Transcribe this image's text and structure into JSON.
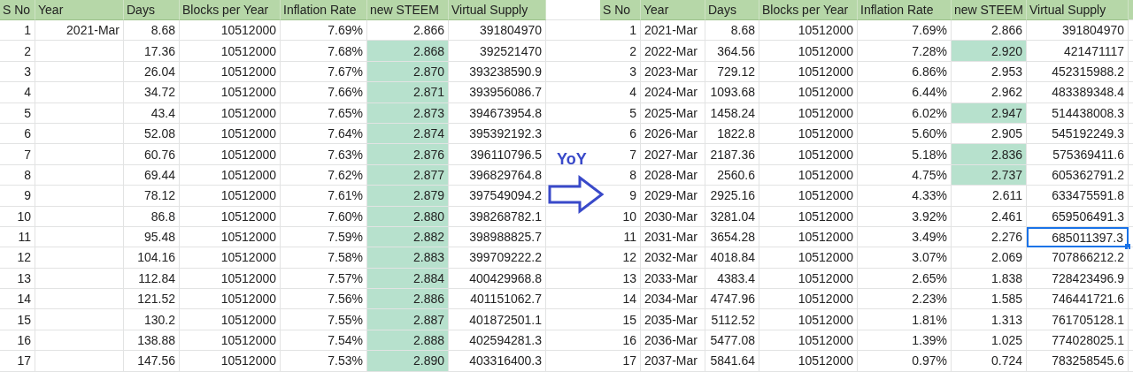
{
  "tables": [
    {
      "columns": [
        "S No",
        "Year",
        "Days",
        "Blocks per Year",
        "Inflation Rate",
        "new STEEM",
        "Virtual Supply"
      ],
      "rows": [
        {
          "s_no": "1",
          "year": "2021-Mar",
          "days": "8.68",
          "blocks_per_year": "10512000",
          "inflation_rate": "7.69%",
          "new_steem": "2.866",
          "virtual_supply": "391804970",
          "new_steem_highlighted": false,
          "selected": false
        },
        {
          "s_no": "2",
          "days": "17.36",
          "blocks_per_year": "10512000",
          "inflation_rate": "7.68%",
          "new_steem": "2.868",
          "virtual_supply": "392521470",
          "new_steem_highlighted": true,
          "selected": false
        },
        {
          "s_no": "3",
          "days": "26.04",
          "blocks_per_year": "10512000",
          "inflation_rate": "7.67%",
          "new_steem": "2.870",
          "virtual_supply": "393238590.9",
          "new_steem_highlighted": true,
          "selected": false
        },
        {
          "s_no": "4",
          "days": "34.72",
          "blocks_per_year": "10512000",
          "inflation_rate": "7.66%",
          "new_steem": "2.871",
          "virtual_supply": "393956086.7",
          "new_steem_highlighted": true,
          "selected": false
        },
        {
          "s_no": "5",
          "days": "43.4",
          "blocks_per_year": "10512000",
          "inflation_rate": "7.65%",
          "new_steem": "2.873",
          "virtual_supply": "394673954.8",
          "new_steem_highlighted": true,
          "selected": false
        },
        {
          "s_no": "6",
          "days": "52.08",
          "blocks_per_year": "10512000",
          "inflation_rate": "7.64%",
          "new_steem": "2.874",
          "virtual_supply": "395392192.3",
          "new_steem_highlighted": true,
          "selected": false
        },
        {
          "s_no": "7",
          "days": "60.76",
          "blocks_per_year": "10512000",
          "inflation_rate": "7.63%",
          "new_steem": "2.876",
          "virtual_supply": "396110796.5",
          "new_steem_highlighted": true,
          "selected": false
        },
        {
          "s_no": "8",
          "days": "69.44",
          "blocks_per_year": "10512000",
          "inflation_rate": "7.62%",
          "new_steem": "2.877",
          "virtual_supply": "396829764.8",
          "new_steem_highlighted": true,
          "selected": false
        },
        {
          "s_no": "9",
          "days": "78.12",
          "blocks_per_year": "10512000",
          "inflation_rate": "7.61%",
          "new_steem": "2.879",
          "virtual_supply": "397549094.2",
          "new_steem_highlighted": true,
          "selected": false
        },
        {
          "s_no": "10",
          "days": "86.8",
          "blocks_per_year": "10512000",
          "inflation_rate": "7.60%",
          "new_steem": "2.880",
          "virtual_supply": "398268782.1",
          "new_steem_highlighted": true,
          "selected": false
        },
        {
          "s_no": "11",
          "days": "95.48",
          "blocks_per_year": "10512000",
          "inflation_rate": "7.59%",
          "new_steem": "2.882",
          "virtual_supply": "398988825.7",
          "new_steem_highlighted": true,
          "selected": false
        },
        {
          "s_no": "12",
          "days": "104.16",
          "blocks_per_year": "10512000",
          "inflation_rate": "7.58%",
          "new_steem": "2.883",
          "virtual_supply": "399709222.2",
          "new_steem_highlighted": true,
          "selected": false
        },
        {
          "s_no": "13",
          "days": "112.84",
          "blocks_per_year": "10512000",
          "inflation_rate": "7.57%",
          "new_steem": "2.884",
          "virtual_supply": "400429968.8",
          "new_steem_highlighted": true,
          "selected": false
        },
        {
          "s_no": "14",
          "days": "121.52",
          "blocks_per_year": "10512000",
          "inflation_rate": "7.56%",
          "new_steem": "2.886",
          "virtual_supply": "401151062.7",
          "new_steem_highlighted": true,
          "selected": false
        },
        {
          "s_no": "15",
          "days": "130.2",
          "blocks_per_year": "10512000",
          "inflation_rate": "7.55%",
          "new_steem": "2.887",
          "virtual_supply": "401872501.1",
          "new_steem_highlighted": true,
          "selected": false
        },
        {
          "s_no": "16",
          "days": "138.88",
          "blocks_per_year": "10512000",
          "inflation_rate": "7.54%",
          "new_steem": "2.888",
          "virtual_supply": "402594281.3",
          "new_steem_highlighted": true,
          "selected": false
        },
        {
          "s_no": "17",
          "days": "147.56",
          "blocks_per_year": "10512000",
          "inflation_rate": "7.53%",
          "new_steem": "2.890",
          "virtual_supply": "403316400.3",
          "new_steem_highlighted": true,
          "selected": false
        }
      ]
    },
    {
      "columns": [
        "S No",
        "Year",
        "Days",
        "Blocks per Year",
        "Inflation Rate",
        "new STEEM",
        "Virtual Supply"
      ],
      "rows": [
        {
          "s_no": "1",
          "year": "2021-Mar",
          "days": "8.68",
          "blocks_per_year": "10512000",
          "inflation_rate": "7.69%",
          "new_steem": "2.866",
          "virtual_supply": "391804970",
          "new_steem_highlighted": false,
          "selected": false
        },
        {
          "s_no": "2",
          "year": "2022-Mar",
          "days": "364.56",
          "blocks_per_year": "10512000",
          "inflation_rate": "7.28%",
          "new_steem": "2.920",
          "virtual_supply": "421471117",
          "new_steem_highlighted": true,
          "selected": false
        },
        {
          "s_no": "3",
          "year": "2023-Mar",
          "days": "729.12",
          "blocks_per_year": "10512000",
          "inflation_rate": "6.86%",
          "new_steem": "2.953",
          "virtual_supply": "452315988.2",
          "new_steem_highlighted": false,
          "selected": false
        },
        {
          "s_no": "4",
          "year": "2024-Mar",
          "days": "1093.68",
          "blocks_per_year": "10512000",
          "inflation_rate": "6.44%",
          "new_steem": "2.962",
          "virtual_supply": "483389348.4",
          "new_steem_highlighted": false,
          "selected": false
        },
        {
          "s_no": "5",
          "year": "2025-Mar",
          "days": "1458.24",
          "blocks_per_year": "10512000",
          "inflation_rate": "6.02%",
          "new_steem": "2.947",
          "virtual_supply": "514438008.3",
          "new_steem_highlighted": true,
          "selected": false
        },
        {
          "s_no": "6",
          "year": "2026-Mar",
          "days": "1822.8",
          "blocks_per_year": "10512000",
          "inflation_rate": "5.60%",
          "new_steem": "2.905",
          "virtual_supply": "545192249.3",
          "new_steem_highlighted": false,
          "selected": false
        },
        {
          "s_no": "7",
          "year": "2027-Mar",
          "days": "2187.36",
          "blocks_per_year": "10512000",
          "inflation_rate": "5.18%",
          "new_steem": "2.836",
          "virtual_supply": "575369411.6",
          "new_steem_highlighted": true,
          "selected": false
        },
        {
          "s_no": "8",
          "year": "2028-Mar",
          "days": "2560.6",
          "blocks_per_year": "10512000",
          "inflation_rate": "4.75%",
          "new_steem": "2.737",
          "virtual_supply": "605362791.2",
          "new_steem_highlighted": true,
          "selected": false
        },
        {
          "s_no": "9",
          "year": "2029-Mar",
          "days": "2925.16",
          "blocks_per_year": "10512000",
          "inflation_rate": "4.33%",
          "new_steem": "2.611",
          "virtual_supply": "633475591.8",
          "new_steem_highlighted": false,
          "selected": false
        },
        {
          "s_no": "10",
          "year": "2030-Mar",
          "days": "3281.04",
          "blocks_per_year": "10512000",
          "inflation_rate": "3.92%",
          "new_steem": "2.461",
          "virtual_supply": "659506491.3",
          "new_steem_highlighted": false,
          "selected": false
        },
        {
          "s_no": "11",
          "year": "2031-Mar",
          "days": "3654.28",
          "blocks_per_year": "10512000",
          "inflation_rate": "3.49%",
          "new_steem": "2.276",
          "virtual_supply": "685011397.3",
          "new_steem_highlighted": false,
          "selected": true
        },
        {
          "s_no": "12",
          "year": "2032-Mar",
          "days": "4018.84",
          "blocks_per_year": "10512000",
          "inflation_rate": "3.07%",
          "new_steem": "2.069",
          "virtual_supply": "707866212.2",
          "new_steem_highlighted": false,
          "selected": false
        },
        {
          "s_no": "13",
          "year": "2033-Mar",
          "days": "4383.4",
          "blocks_per_year": "10512000",
          "inflation_rate": "2.65%",
          "new_steem": "1.838",
          "virtual_supply": "728423496.9",
          "new_steem_highlighted": false,
          "selected": false
        },
        {
          "s_no": "14",
          "year": "2034-Mar",
          "days": "4747.96",
          "blocks_per_year": "10512000",
          "inflation_rate": "2.23%",
          "new_steem": "1.585",
          "virtual_supply": "746441721.6",
          "new_steem_highlighted": false,
          "selected": false
        },
        {
          "s_no": "15",
          "year": "2035-Mar",
          "days": "5112.52",
          "blocks_per_year": "10512000",
          "inflation_rate": "1.81%",
          "new_steem": "1.313",
          "virtual_supply": "761705128.1",
          "new_steem_highlighted": false,
          "selected": false
        },
        {
          "s_no": "16",
          "year": "2036-Mar",
          "days": "5477.08",
          "blocks_per_year": "10512000",
          "inflation_rate": "1.39%",
          "new_steem": "1.025",
          "virtual_supply": "774028025.1",
          "new_steem_highlighted": false,
          "selected": false
        },
        {
          "s_no": "17",
          "year": "2037-Mar",
          "days": "5841.64",
          "blocks_per_year": "10512000",
          "inflation_rate": "0.97%",
          "new_steem": "0.724",
          "virtual_supply": "783258545.6",
          "new_steem_highlighted": false,
          "selected": false
        }
      ]
    }
  ],
  "annotation": {
    "label": "YoY"
  }
}
